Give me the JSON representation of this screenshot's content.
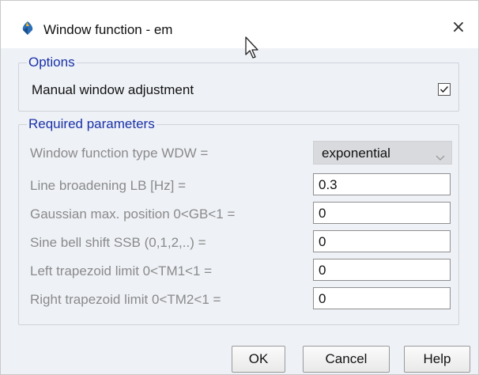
{
  "window": {
    "title": "Window function - em",
    "close_glyph": "×"
  },
  "options": {
    "title": "Options",
    "manual_label": "Manual window adjustment",
    "manual_checked": true
  },
  "required": {
    "title": "Required parameters",
    "rows": [
      {
        "label": "Window function type WDW =",
        "value": "exponential",
        "kind": "select"
      },
      {
        "label": "Line broadening LB [Hz] =",
        "value": "0.3",
        "kind": "input"
      },
      {
        "label": "Gaussian max. position 0<GB<1 =",
        "value": "0",
        "kind": "input"
      },
      {
        "label": "Sine bell shift SSB (0,1,2,..) =",
        "value": "0",
        "kind": "input"
      },
      {
        "label": "Left trapezoid limit 0<TM1<1 =",
        "value": "0",
        "kind": "input"
      },
      {
        "label": "Right trapezoid limit 0<TM2<1 =",
        "value": "0",
        "kind": "input"
      }
    ]
  },
  "buttons": {
    "ok": "OK",
    "cancel": "Cancel",
    "help": "Help"
  },
  "icons": {
    "app": "topspin-app-icon",
    "checkbox_check": "check-icon",
    "dropdown": "chevron-down-icon",
    "cursor": "mouse-cursor-icon"
  },
  "colors": {
    "group_title": "#1a31a8",
    "disabled_label": "#8a8a8a",
    "panel_bg": "#eef1f6"
  }
}
